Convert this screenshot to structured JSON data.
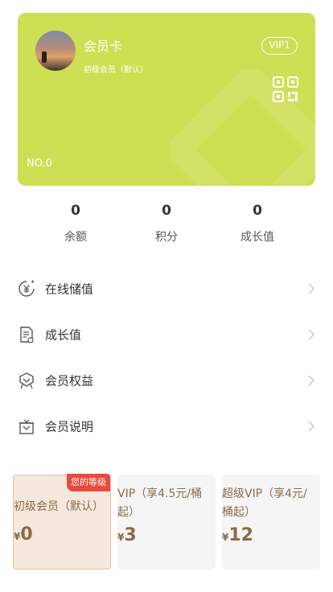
{
  "card": {
    "title": "会员卡",
    "level": "初级会员（默认）",
    "vip_badge": "VIP1",
    "number": "NO.0",
    "color": "#cddf53"
  },
  "stats": [
    {
      "value": "0",
      "label": "余额"
    },
    {
      "value": "0",
      "label": "积分"
    },
    {
      "value": "0",
      "label": "成长值"
    }
  ],
  "menu": [
    {
      "label": "在线储值",
      "icon": "yen-coin-icon"
    },
    {
      "label": "成长值",
      "icon": "document-icon"
    },
    {
      "label": "会员权益",
      "icon": "badge-icon"
    },
    {
      "label": "会员说明",
      "icon": "gift-icon"
    }
  ],
  "levels": [
    {
      "name": "初级会员（默认）",
      "currency": "¥",
      "price": "0",
      "tag": "您的等级"
    },
    {
      "name": "VIP（享4.5元/桶起）",
      "currency": "¥",
      "price": "3"
    },
    {
      "name": "超级VIP（享4元/桶起）",
      "currency": "¥",
      "price": "12"
    }
  ]
}
